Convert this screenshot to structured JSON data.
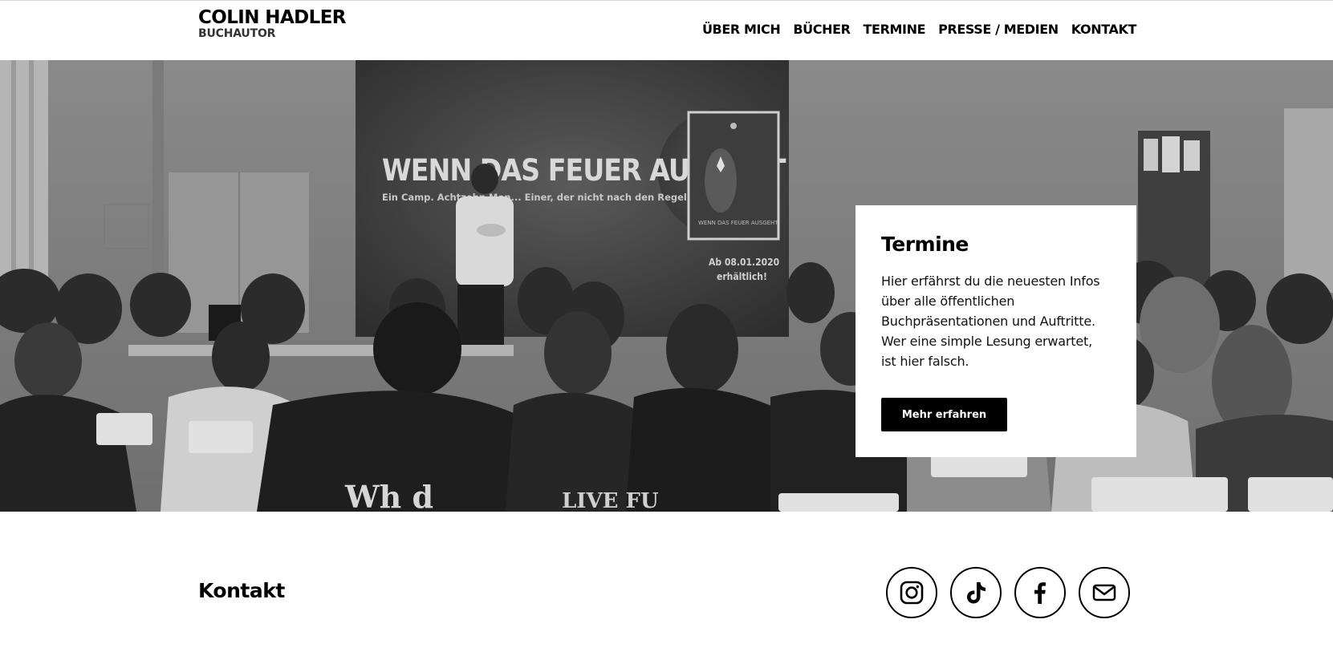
{
  "header": {
    "brand_name": "COLIN HADLER",
    "brand_sub": "BUCHAUTOR",
    "nav": [
      {
        "label": "ÜBER MICH"
      },
      {
        "label": "BÜCHER"
      },
      {
        "label": "TERMINE"
      },
      {
        "label": "PRESSE / MEDIEN"
      },
      {
        "label": "KONTAKT"
      }
    ]
  },
  "hero": {
    "photo_description_icon": "event-photo",
    "slide_headline": "WENN DAS FEUER AUSGEHT",
    "slide_tagline": "Ein Camp. Achtzehn Men... Einer, der nicht nach den Regeln spielt.",
    "book_cover_title": "WENN DAS FEUER AUSGEHT",
    "release_note_line1": "Ab 08.01.2020",
    "release_note_line2": "erhältlich!",
    "card": {
      "title": "Termine",
      "text": "Hier erfährst du die neuesten Infos über alle öffentlichen Buchpräsentationen und Auftritte. Wer eine simple Lesung erwartet, ist hier falsch.",
      "button_label": "Mehr erfahren"
    }
  },
  "footer": {
    "title": "Kontakt",
    "socials": [
      {
        "icon": "instagram-icon"
      },
      {
        "icon": "tiktok-icon"
      },
      {
        "icon": "facebook-icon"
      },
      {
        "icon": "mail-icon"
      }
    ]
  },
  "colors": {
    "text": "#000000",
    "button_bg": "#000000",
    "button_text": "#ffffff",
    "background": "#ffffff"
  }
}
